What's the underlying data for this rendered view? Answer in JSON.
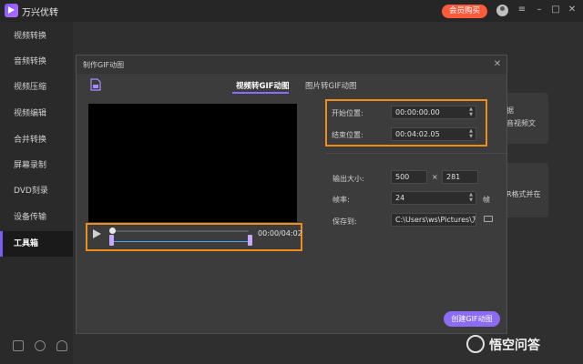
{
  "app": {
    "title": "万兴优转",
    "vip_label": "会员购买"
  },
  "sidebar": {
    "items": [
      {
        "label": "视频转换"
      },
      {
        "label": "音频转换"
      },
      {
        "label": "视频压缩"
      },
      {
        "label": "视频编辑"
      },
      {
        "label": "合并转换"
      },
      {
        "label": "屏幕录制"
      },
      {
        "label": "DVD刻录"
      },
      {
        "label": "设备传输"
      },
      {
        "label": "工具箱"
      }
    ],
    "active": "工具箱"
  },
  "background_cards": [
    {
      "line1": "据",
      "line2": "音视频文"
    },
    {
      "line1": "R格式并在"
    }
  ],
  "dialog": {
    "title": "制作GIF动图",
    "tabs": [
      {
        "label": "视频转GIF动图",
        "active": true
      },
      {
        "label": "图片转GIF动图",
        "active": false
      }
    ],
    "player": {
      "time": "00:00/04:02",
      "progress": 0
    },
    "start": {
      "label": "开始位置:",
      "value": "00:00:00.00"
    },
    "end": {
      "label": "结束位置:",
      "value": "00:04:02.05"
    },
    "output_size": {
      "label": "输出大小:",
      "width": "500",
      "times": "×",
      "height": "281"
    },
    "frame_rate": {
      "label": "帧率:",
      "value": "24",
      "unit": "帧"
    },
    "save_to": {
      "label": "保存到:",
      "value": "C:\\Users\\ws\\Pictures\\万兴"
    },
    "create_label": "创建GIF动图"
  },
  "watermark": {
    "text": "悟空问答"
  },
  "colors": {
    "accent": "#8b6cf2",
    "highlight": "#f08c1a",
    "vip": "#ff5a3c"
  }
}
